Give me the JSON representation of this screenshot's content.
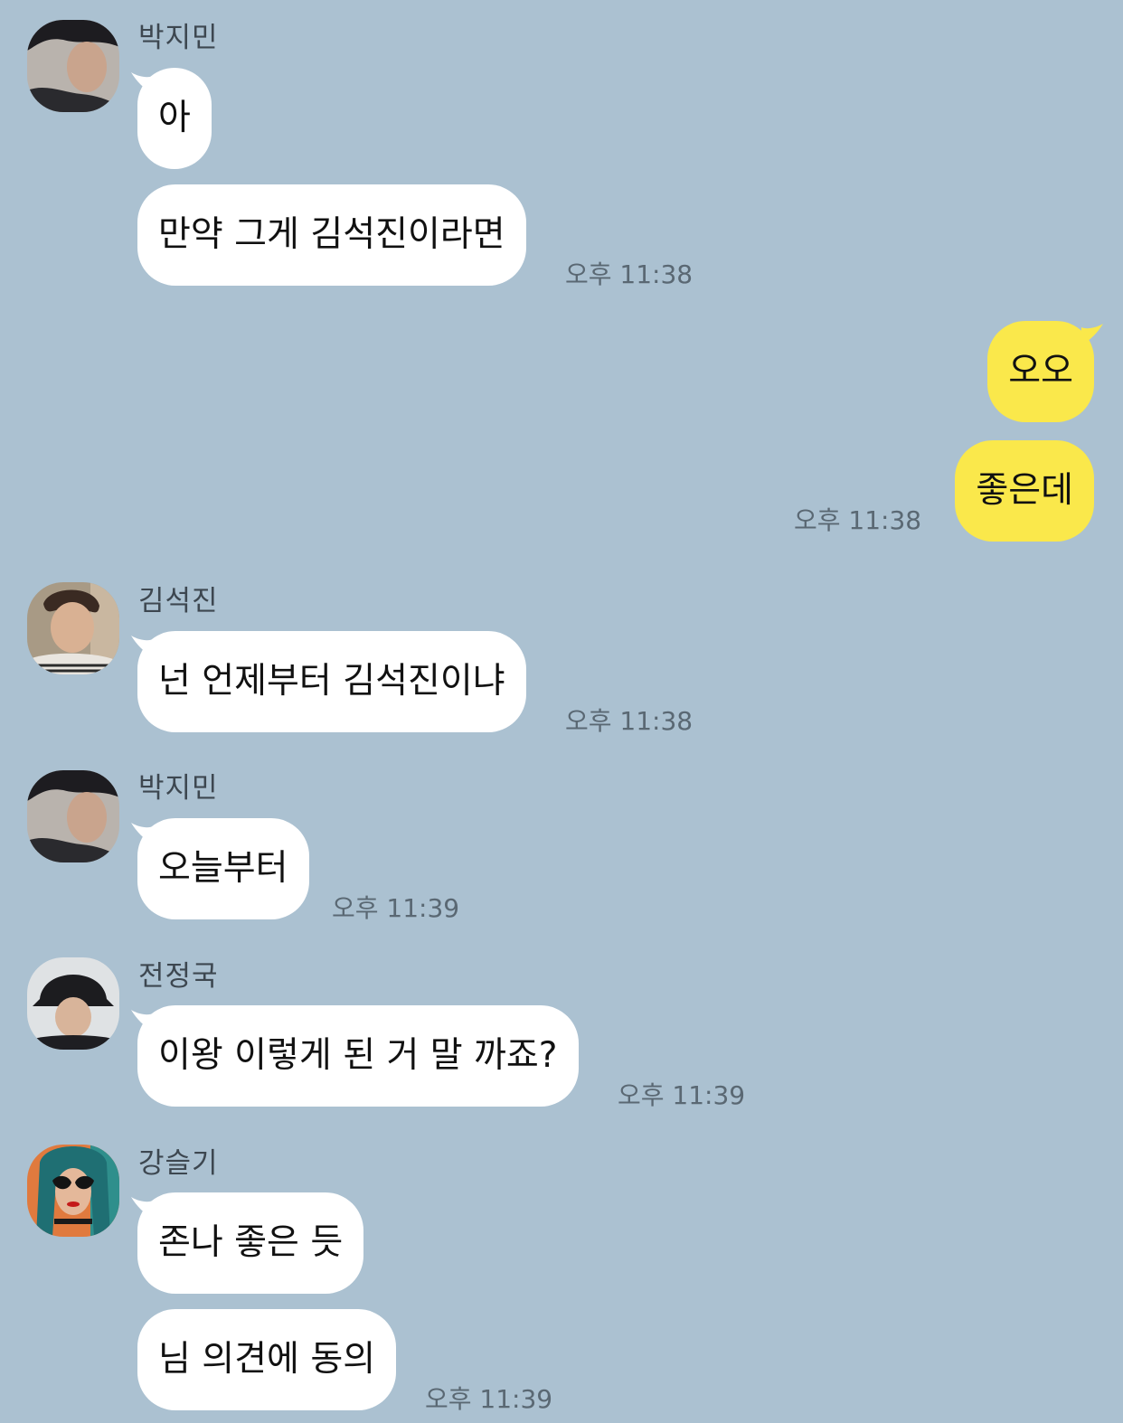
{
  "chat": {
    "messages": [
      {
        "sender": "박지민",
        "text": "아"
      },
      {
        "text": "만약 그게 김석진이라면",
        "time": "오후 11:38"
      },
      {
        "text": "오오"
      },
      {
        "text": "좋은데",
        "time": "오후 11:38"
      },
      {
        "sender": "김석진",
        "text": "넌 언제부터 김석진이냐",
        "time": "오후 11:38"
      },
      {
        "sender": "박지민",
        "text": "오늘부터",
        "time": "오후 11:39"
      },
      {
        "sender": "전정국",
        "text": "이왕 이렇게 된 거 말 까죠?",
        "time": "오후 11:39"
      },
      {
        "sender": "강슬기",
        "text": "존나 좋은 듯"
      },
      {
        "text": "님 의견에 동의",
        "time": "오후 11:39"
      }
    ]
  },
  "colors": {
    "background": "#abc1d1",
    "incoming_bubble": "#ffffff",
    "outgoing_bubble": "#fae84b",
    "timestamp": "#5a6873"
  }
}
